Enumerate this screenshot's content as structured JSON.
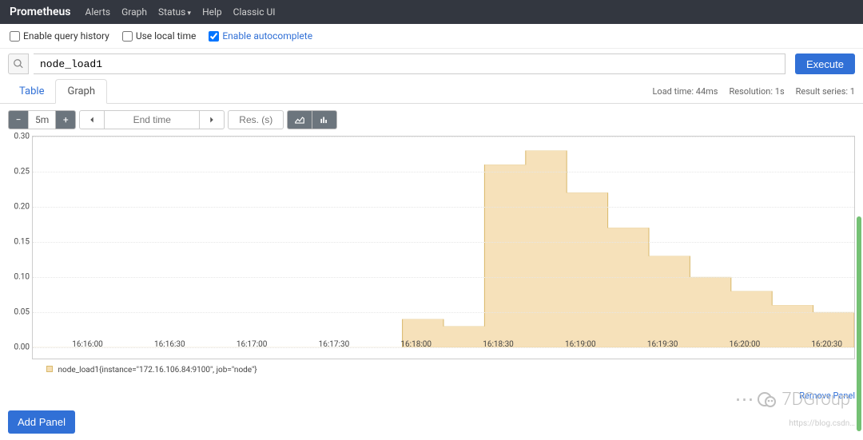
{
  "nav": {
    "brand": "Prometheus",
    "items": [
      "Alerts",
      "Graph",
      "Status",
      "Help",
      "Classic UI"
    ]
  },
  "options": {
    "history": "Enable query history",
    "localtime": "Use local time",
    "autocomplete": "Enable autocomplete"
  },
  "query": {
    "value": "node_load1",
    "execute": "Execute"
  },
  "tabs": {
    "table": "Table",
    "graph": "Graph"
  },
  "meta": {
    "load": "Load time: 44ms",
    "res": "Resolution: 1s",
    "series": "Result series: 1"
  },
  "controls": {
    "range": "5m",
    "endtime_ph": "End time",
    "resolution_ph": "Res. (s)"
  },
  "legend": {
    "metric": "node_load1",
    "labels": "{instance=\"172.16.106.84:9100\", job=\"node\"}"
  },
  "actions": {
    "remove": "Remove Panel",
    "add": "Add Panel"
  },
  "watermark": "7DGroup",
  "chart_data": {
    "type": "area",
    "title": "",
    "xlabel": "",
    "ylabel": "",
    "ylim": [
      0.0,
      0.3
    ],
    "y_ticks": [
      0.0,
      0.05,
      0.1,
      0.15,
      0.2,
      0.25,
      0.3
    ],
    "x_ticks": [
      "16:16:00",
      "16:16:30",
      "16:17:00",
      "16:17:30",
      "16:18:00",
      "16:18:30",
      "16:19:00",
      "16:19:30",
      "16:20:00",
      "16:20:30"
    ],
    "series": [
      {
        "name": "node_load1{instance=\"172.16.106.84:9100\", job=\"node\"}",
        "color": "#f5deb3",
        "points": [
          {
            "t": "16:15:40",
            "v": 0.0
          },
          {
            "t": "16:17:55",
            "v": 0.0
          },
          {
            "t": "16:17:55",
            "v": 0.04
          },
          {
            "t": "16:18:10",
            "v": 0.04
          },
          {
            "t": "16:18:10",
            "v": 0.03
          },
          {
            "t": "16:18:25",
            "v": 0.03
          },
          {
            "t": "16:18:25",
            "v": 0.26
          },
          {
            "t": "16:18:40",
            "v": 0.26
          },
          {
            "t": "16:18:40",
            "v": 0.28
          },
          {
            "t": "16:18:55",
            "v": 0.28
          },
          {
            "t": "16:18:55",
            "v": 0.22
          },
          {
            "t": "16:19:10",
            "v": 0.22
          },
          {
            "t": "16:19:10",
            "v": 0.17
          },
          {
            "t": "16:19:25",
            "v": 0.17
          },
          {
            "t": "16:19:25",
            "v": 0.13
          },
          {
            "t": "16:19:40",
            "v": 0.13
          },
          {
            "t": "16:19:40",
            "v": 0.1
          },
          {
            "t": "16:19:55",
            "v": 0.1
          },
          {
            "t": "16:19:55",
            "v": 0.08
          },
          {
            "t": "16:20:10",
            "v": 0.08
          },
          {
            "t": "16:20:10",
            "v": 0.06
          },
          {
            "t": "16:20:25",
            "v": 0.06
          },
          {
            "t": "16:20:25",
            "v": 0.05
          },
          {
            "t": "16:20:40",
            "v": 0.05
          }
        ]
      }
    ],
    "x_domain_seconds": {
      "start": 58540,
      "end": 58840
    }
  }
}
